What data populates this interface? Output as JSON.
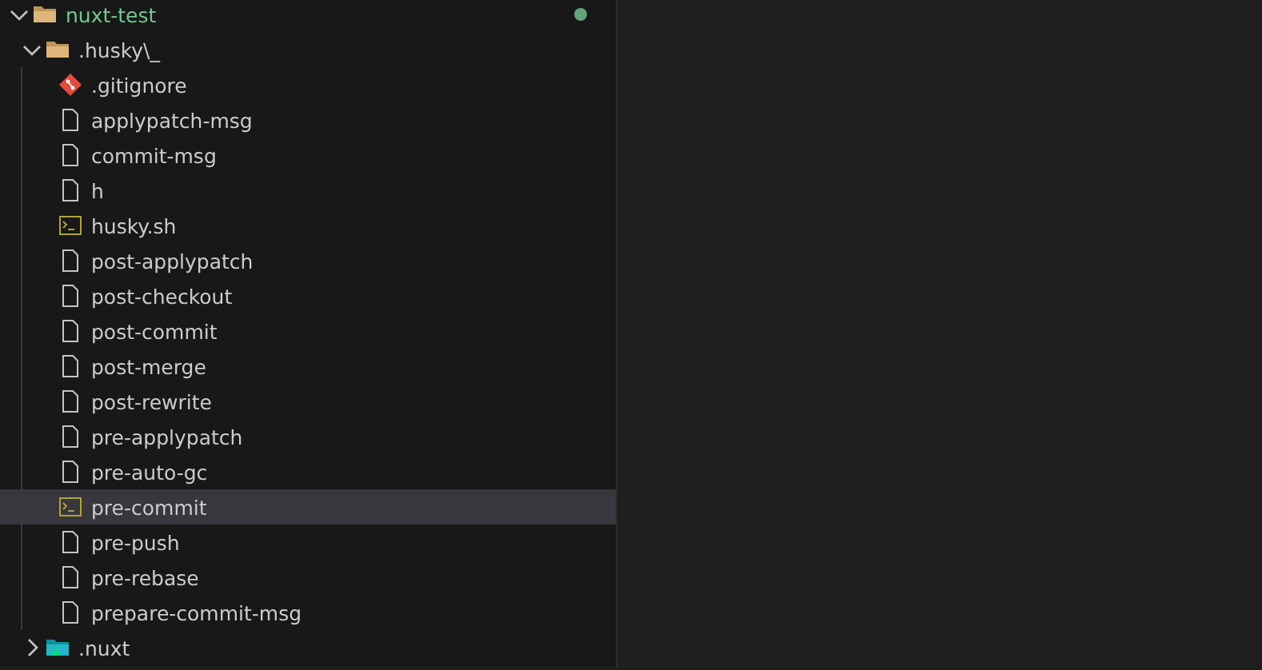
{
  "explorer": {
    "tree": [
      {
        "kind": "folder",
        "label": "nuxt-test",
        "expanded": true,
        "selected": false,
        "color": "#73c991",
        "dot": true,
        "children": [
          {
            "kind": "folder",
            "label": ".husky\\_",
            "expanded": true,
            "selected": false,
            "children": [
              {
                "kind": "git",
                "label": ".gitignore",
                "selected": false
              },
              {
                "kind": "file",
                "label": "applypatch-msg",
                "selected": false
              },
              {
                "kind": "file",
                "label": "commit-msg",
                "selected": false
              },
              {
                "kind": "file",
                "label": "h",
                "selected": false
              },
              {
                "kind": "shell",
                "label": "husky.sh",
                "selected": false
              },
              {
                "kind": "file",
                "label": "post-applypatch",
                "selected": false
              },
              {
                "kind": "file",
                "label": "post-checkout",
                "selected": false
              },
              {
                "kind": "file",
                "label": "post-commit",
                "selected": false
              },
              {
                "kind": "file",
                "label": "post-merge",
                "selected": false
              },
              {
                "kind": "file",
                "label": "post-rewrite",
                "selected": false
              },
              {
                "kind": "file",
                "label": "pre-applypatch",
                "selected": false
              },
              {
                "kind": "file",
                "label": "pre-auto-gc",
                "selected": false
              },
              {
                "kind": "shell",
                "label": "pre-commit",
                "selected": true
              },
              {
                "kind": "file",
                "label": "pre-push",
                "selected": false
              },
              {
                "kind": "file",
                "label": "pre-rebase",
                "selected": false
              },
              {
                "kind": "file",
                "label": "prepare-commit-msg",
                "selected": false
              }
            ]
          },
          {
            "kind": "nuxtfolder",
            "label": ".nuxt",
            "expanded": false,
            "selected": false
          }
        ]
      }
    ]
  }
}
